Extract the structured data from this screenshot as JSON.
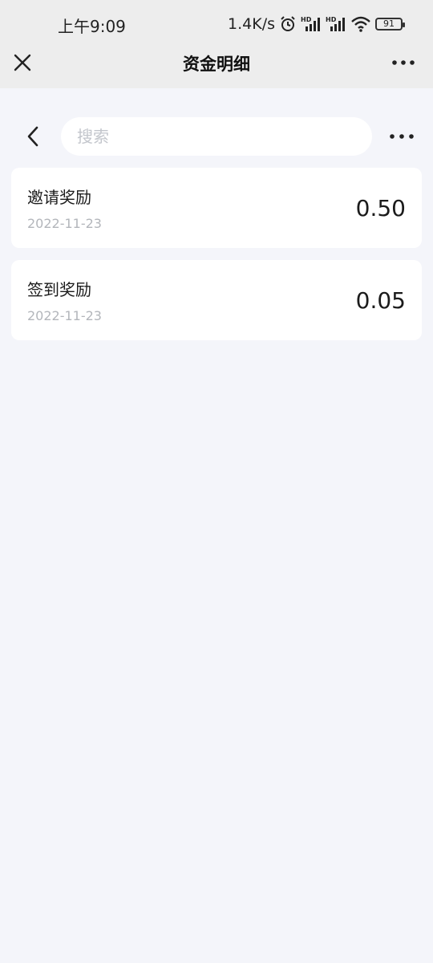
{
  "status_bar": {
    "time": "上午9:09",
    "net_speed": "1.4K/s",
    "battery": "91",
    "icons": [
      "alarm-icon",
      "hd-signal-icon",
      "hd-signal-icon",
      "wifi-icon",
      "battery-icon"
    ]
  },
  "header": {
    "title": "资金明细",
    "close_icon": "close-icon",
    "more_icon": "more-icon"
  },
  "search": {
    "placeholder": "搜索",
    "value": "",
    "back_icon": "chevron-left-icon",
    "more_icon": "more-icon"
  },
  "records": [
    {
      "title": "邀请奖励",
      "date": "2022-11-23",
      "amount": "0.50"
    },
    {
      "title": "签到奖励",
      "date": "2022-11-23",
      "amount": "0.05"
    }
  ],
  "colors": {
    "background": "#f4f5fa",
    "bar": "#ededed",
    "card": "#ffffff",
    "muted": "#b3b6bb"
  }
}
